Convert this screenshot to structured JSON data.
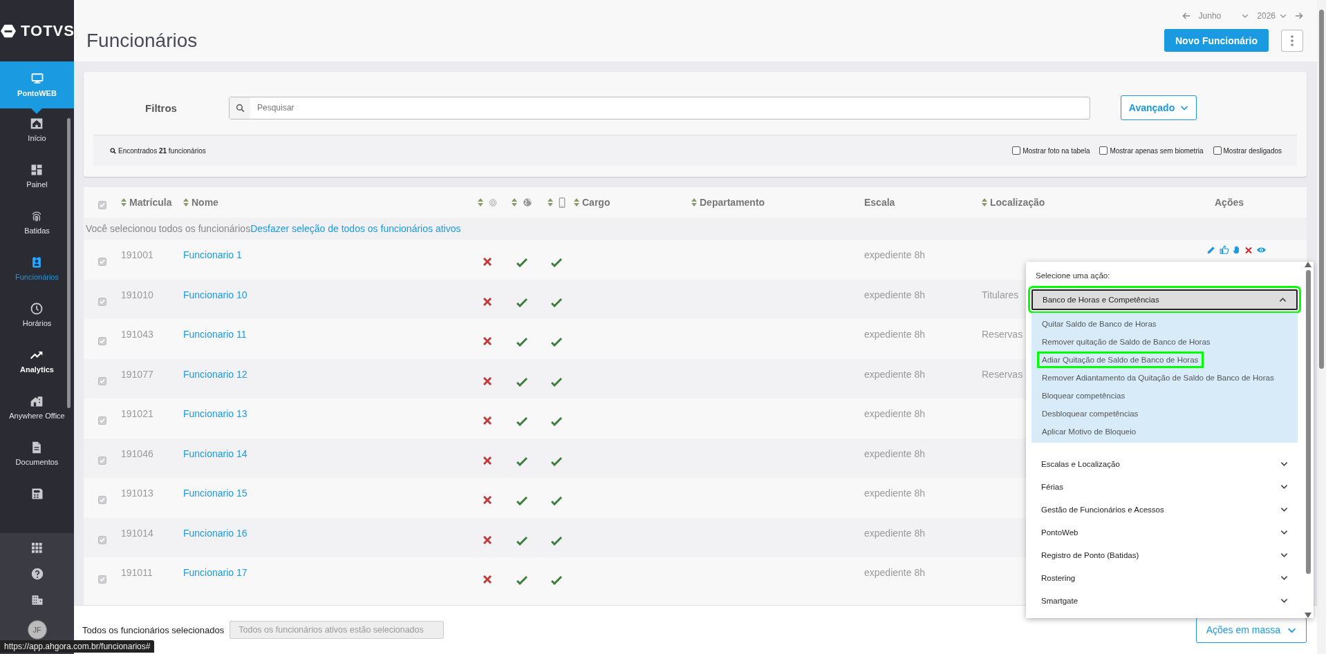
{
  "sidebar": {
    "logo": "TOTVS",
    "product": {
      "label": "PontoWEB"
    },
    "items": [
      {
        "label": "Início",
        "selected": false,
        "hovered": false
      },
      {
        "label": "Painel",
        "selected": false,
        "hovered": false
      },
      {
        "label": "Batidas",
        "selected": false,
        "hovered": false
      },
      {
        "label": "Funcionários",
        "selected": true,
        "hovered": false
      },
      {
        "label": "Horários",
        "selected": false,
        "hovered": false
      },
      {
        "label": "Analytics",
        "selected": false,
        "hovered": true
      },
      {
        "label": "Anywhere Office",
        "selected": false,
        "hovered": false
      },
      {
        "label": "Documentos",
        "selected": false,
        "hovered": false
      },
      {
        "selected": false,
        "hovered": false
      }
    ],
    "avatar": "JF"
  },
  "header": {
    "title": "Funcionários",
    "month": "Junho",
    "year": "2026",
    "primary_button": "Novo Funcionário"
  },
  "filters": {
    "label": "Filtros",
    "search_placeholder": "Pesquisar",
    "advanced_button": "Avançado",
    "found": "Encontrados **21** funcionários",
    "options": [
      {
        "label": "Mostrar foto na tabela",
        "checked": false
      },
      {
        "label": "Mostrar apenas sem biometria",
        "checked": false
      },
      {
        "label": "Mostrar desligados",
        "checked": false
      }
    ]
  },
  "table": {
    "all_checked": true,
    "columns": [
      {
        "label": "Matrícula",
        "sortable": true
      },
      {
        "label": "Nome",
        "sortable": true
      },
      {
        "sortable": true
      },
      {
        "sortable": true
      },
      {
        "sortable": true
      },
      {
        "label": "Cargo",
        "sortable": true
      },
      {
        "label": "Departamento",
        "sortable": true
      },
      {
        "label": "Escala",
        "sortable": false
      },
      {
        "label": "Localização",
        "sortable": true
      },
      {
        "label": "Ações",
        "sortable": false
      }
    ],
    "selection_notice": "Você selecionou todos os funcionários",
    "selection_undo": "Desfazer seleção de todos os funcionários ativos",
    "rows": [
      {
        "checked": true,
        "matricula": "191001",
        "nome": "Funcionario 1",
        "biometria": false,
        "web": true,
        "mobile": true,
        "escala": "expediente 8h",
        "actions_shown": true
      },
      {
        "checked": true,
        "matricula": "191010",
        "nome": "Funcionario 10",
        "biometria": false,
        "web": true,
        "mobile": true,
        "escala": "expediente 8h",
        "localizacao": "Titulares",
        "actions_shown": false
      },
      {
        "checked": true,
        "matricula": "191043",
        "nome": "Funcionario 11",
        "biometria": false,
        "web": true,
        "mobile": true,
        "escala": "expediente 8h",
        "localizacao": "Reservas",
        "actions_shown": false
      },
      {
        "checked": true,
        "matricula": "191077",
        "nome": "Funcionario 12",
        "biometria": false,
        "web": true,
        "mobile": true,
        "escala": "expediente 8h",
        "localizacao": "Reservas",
        "actions_shown": false
      },
      {
        "checked": true,
        "matricula": "191021",
        "nome": "Funcionario 13",
        "biometria": false,
        "web": true,
        "mobile": true,
        "escala": "expediente 8h",
        "actions_shown": false
      },
      {
        "checked": true,
        "matricula": "191046",
        "nome": "Funcionario 14",
        "biometria": false,
        "web": true,
        "mobile": true,
        "escala": "expediente 8h",
        "actions_shown": false
      },
      {
        "checked": true,
        "matricula": "191013",
        "nome": "Funcionario 15",
        "biometria": false,
        "web": true,
        "mobile": true,
        "escala": "expediente 8h",
        "actions_shown": false
      },
      {
        "checked": true,
        "matricula": "191014",
        "nome": "Funcionario 16",
        "biometria": false,
        "web": true,
        "mobile": true,
        "escala": "expediente 8h",
        "actions_shown": false
      },
      {
        "checked": true,
        "matricula": "191011",
        "nome": "Funcionario 17",
        "biometria": false,
        "web": true,
        "mobile": true,
        "escala": "expediente 8h",
        "actions_shown": false
      }
    ]
  },
  "footer": {
    "label": "Todos os funcionários selecionados",
    "value": "Todos os funcionários ativos estão selecionados",
    "button": "Ações em massa"
  },
  "action_menu": {
    "title": "Selecione uma ação:",
    "groups": [
      {
        "label": "Banco de Horas e Competências",
        "expanded": true,
        "highlighted": true,
        "items": [
          {
            "label": "Quitar Saldo de Banco de Horas",
            "highlighted": false
          },
          {
            "label": "Remover quitação de Saldo de Banco de Horas",
            "highlighted": false
          },
          {
            "label": "Adiar Quitação de Saldo de Banco de Horas",
            "highlighted": true
          },
          {
            "label": "Remover Adiantamento da Quitação de Saldo de Banco de Horas",
            "highlighted": false
          },
          {
            "label": "Bloquear competências",
            "highlighted": false
          },
          {
            "label": "Desbloquear competências",
            "highlighted": false
          },
          {
            "label": "Aplicar Motivo de Bloqueio",
            "highlighted": false
          }
        ]
      },
      {
        "label": "Escalas e Localização",
        "expanded": false,
        "highlighted": false
      },
      {
        "label": "Férias",
        "expanded": false,
        "highlighted": false
      },
      {
        "label": "Gestão de Funcionários e Acessos",
        "expanded": false,
        "highlighted": false
      },
      {
        "label": "PontoWeb",
        "expanded": false,
        "highlighted": false
      },
      {
        "label": "Registro de Ponto (Batidas)",
        "expanded": false,
        "highlighted": false
      },
      {
        "label": "Rostering",
        "expanded": false,
        "highlighted": false
      },
      {
        "label": "Smartgate",
        "expanded": false,
        "highlighted": false
      }
    ]
  },
  "status_url": "https://app.ahgora.com.br/funcionarios#"
}
